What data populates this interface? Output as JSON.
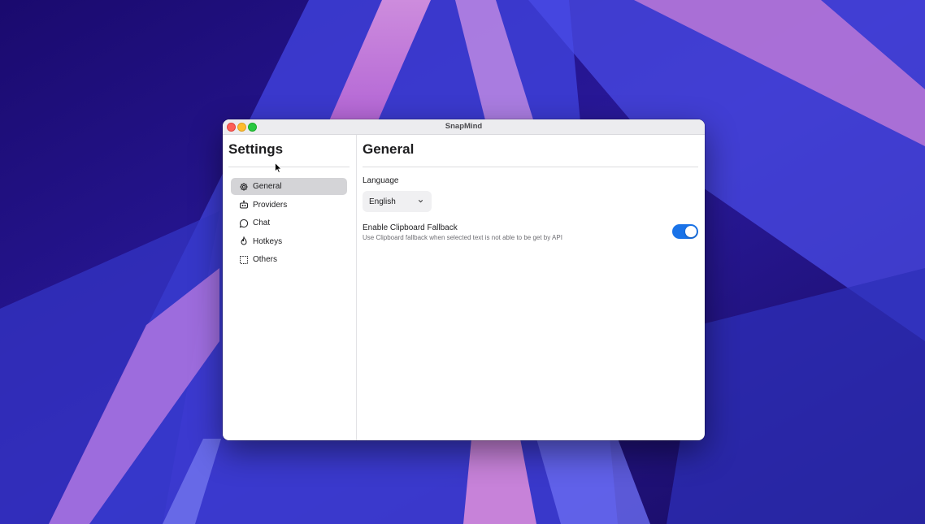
{
  "window": {
    "title": "SnapMind"
  },
  "sidebar": {
    "title": "Settings",
    "items": [
      {
        "label": "General",
        "icon": "gear-icon",
        "active": true
      },
      {
        "label": "Providers",
        "icon": "robot-icon",
        "active": false
      },
      {
        "label": "Chat",
        "icon": "chat-bubble-icon",
        "active": false
      },
      {
        "label": "Hotkeys",
        "icon": "flame-icon",
        "active": false
      },
      {
        "label": "Others",
        "icon": "dashed-square-icon",
        "active": false
      }
    ]
  },
  "main": {
    "title": "General",
    "language": {
      "label": "Language",
      "value": "English"
    },
    "clipboard_fallback": {
      "title": "Enable Clipboard Fallback",
      "description": "Use Clipboard fallback when selected text is not able to be get by API",
      "enabled": true
    }
  },
  "colors": {
    "accent": "#1a73e8",
    "active_item_bg": "#d4d4d7"
  }
}
